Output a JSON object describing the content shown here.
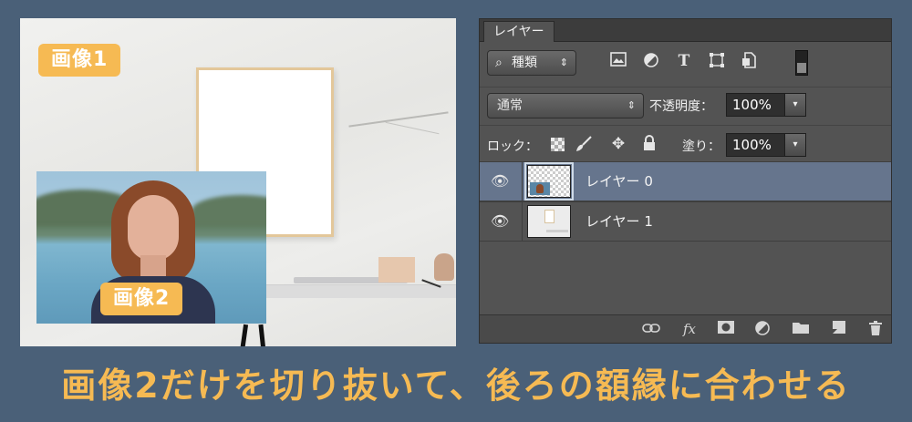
{
  "image_labels": {
    "image1": "画像1",
    "image2": "画像2"
  },
  "panel": {
    "tab": "レイヤー",
    "filter_kind": "種類",
    "blend_mode": "通常",
    "opacity_label": "不透明度：",
    "opacity_value": "100%",
    "lock_label": "ロック：",
    "fill_label": "塗り：",
    "fill_value": "100%",
    "layers": [
      {
        "name": "レイヤー 0",
        "selected": true,
        "visible": true
      },
      {
        "name": "レイヤー 1",
        "selected": false,
        "visible": true
      }
    ],
    "filter_icons": [
      "image-filter-icon",
      "adjustment-filter-icon",
      "type-filter-icon",
      "shape-filter-icon",
      "smart-object-filter-icon"
    ],
    "footer_icons": [
      "link-icon",
      "fx-icon",
      "mask-icon",
      "adjustment-layer-icon",
      "folder-icon",
      "new-layer-icon",
      "trash-icon"
    ],
    "fx_label": "fx",
    "selection_color": "#66758d"
  },
  "caption": "画像2だけを切り抜いて、後ろの額縁に合わせる",
  "colors": {
    "background": "#4a6078",
    "accent": "#f6ba53"
  }
}
